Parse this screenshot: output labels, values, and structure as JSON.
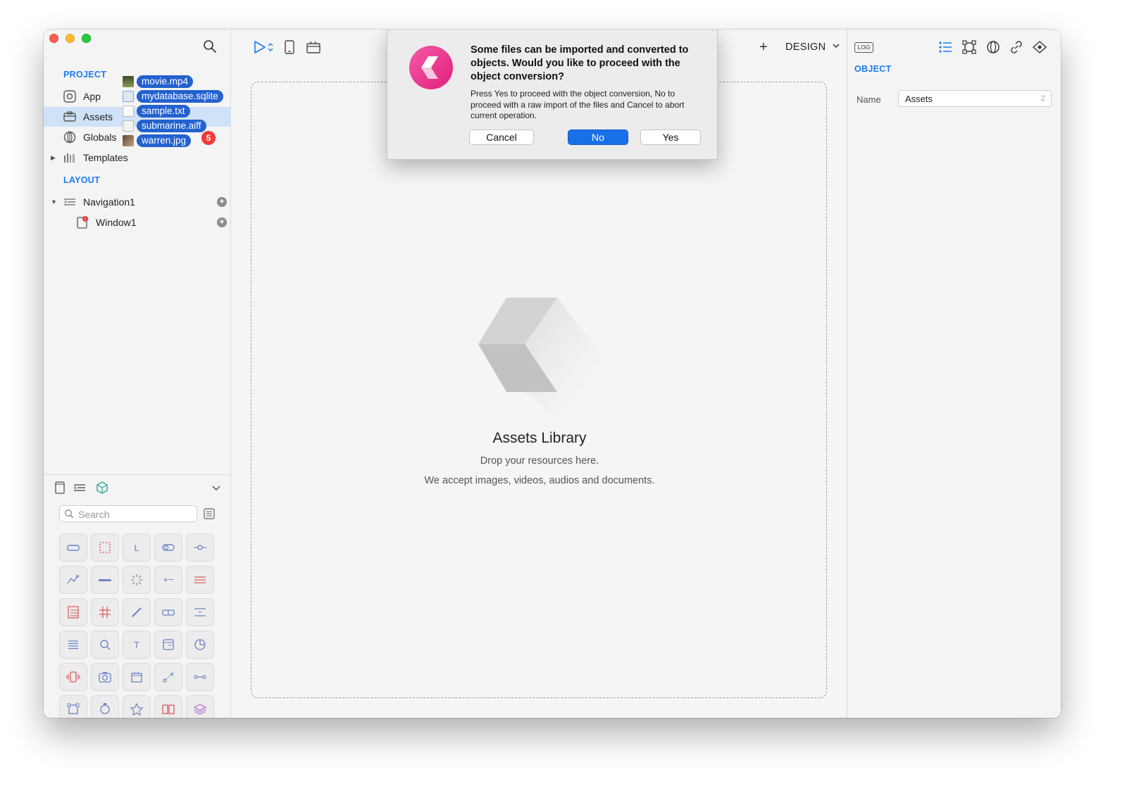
{
  "sidebar": {
    "project_label": "PROJECT",
    "layout_label": "LAYOUT",
    "project_items": [
      {
        "label": "App",
        "icon": "app-icon"
      },
      {
        "label": "Assets",
        "icon": "assets-icon"
      },
      {
        "label": "Globals",
        "icon": "globals-icon"
      },
      {
        "label": "Templates",
        "icon": "templates-icon"
      }
    ],
    "layout_items": [
      {
        "label": "Navigation1",
        "icon": "navigation-icon"
      },
      {
        "label": "Window1",
        "icon": "window-icon"
      }
    ],
    "drag": {
      "files": [
        "movie.mp4",
        "mydatabase.sqlite",
        "sample.txt",
        "submarine.aiff",
        "warren.jpg"
      ],
      "count": "5"
    },
    "library": {
      "search_placeholder": "Search"
    }
  },
  "toolbar": {
    "plus": "+",
    "mode_label": "DESIGN"
  },
  "canvas": {
    "title": "Assets Library",
    "line1": "Drop your resources here.",
    "line2": "We accept images, videos, audios and documents."
  },
  "inspector": {
    "log_label": "LOG",
    "section_label": "OBJECT",
    "name_label": "Name",
    "name_value": "Assets",
    "name_count": "2"
  },
  "dialog": {
    "title": "Some files can be imported and converted to objects. Would you like to proceed with the object conversion?",
    "body": "Press Yes to proceed with the object conversion, No to proceed with a raw import of the files and Cancel to abort current operation.",
    "cancel_label": "Cancel",
    "no_label": "No",
    "yes_label": "Yes"
  },
  "colors": {
    "accent": "#1a7cf0",
    "primary_button": "#1a70e8",
    "selection": "#cfe2f8",
    "drag_pill": "#2361cf",
    "badge": "#f23a3a",
    "app_logo": "#ec2d8c"
  }
}
